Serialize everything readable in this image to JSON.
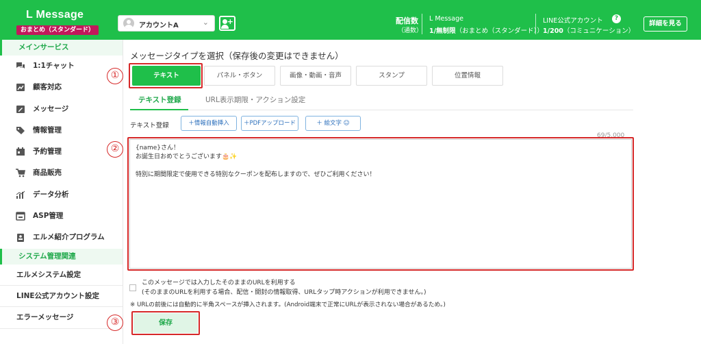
{
  "header": {
    "app_title": "L Message",
    "plan_badge": "おまとめ（スタンダード）",
    "account": "アカウントA",
    "delivery_label": "配信数",
    "delivery_sub": "（通数）",
    "lmessage_name": "L Message",
    "lmessage_value": "1/無制限",
    "lmessage_plan": "（おまとめ（スタンダード））",
    "line_name": "LINE公式アカウント",
    "line_value": "1/200",
    "line_plan": "（コミュニケーション）",
    "detail_button": "詳細を見る",
    "colors": {
      "brand": "#1fbf4a",
      "badge": "#c2185b",
      "annotation": "#d62828"
    }
  },
  "sidebar": {
    "section_main": "メインサービス",
    "items": [
      {
        "label": "1:1チャット",
        "icon": "chat-icon"
      },
      {
        "label": "顧客対応",
        "icon": "customer-icon"
      },
      {
        "label": "メッセージ",
        "icon": "message-icon"
      },
      {
        "label": "情報管理",
        "icon": "tag-icon"
      },
      {
        "label": "予約管理",
        "icon": "calendar-icon"
      },
      {
        "label": "商品販売",
        "icon": "cart-icon"
      },
      {
        "label": "データ分析",
        "icon": "analytics-icon"
      },
      {
        "label": "ASP管理",
        "icon": "asp-icon"
      },
      {
        "label": "エルメ紹介プログラム",
        "icon": "referral-icon"
      }
    ],
    "section_system": "システム管理関連",
    "system_items": [
      {
        "label": "エルメシステム設定"
      },
      {
        "label": "LINE公式アカウント設定"
      },
      {
        "label": "エラーメッセージ"
      }
    ]
  },
  "main": {
    "title": "メッセージタイプを選択（保存後の変更はできません）",
    "type_tabs": [
      {
        "label": "テキスト"
      },
      {
        "label": "パネル・ボタン"
      },
      {
        "label": "画像・動画・音声"
      },
      {
        "label": "スタンプ"
      },
      {
        "label": "位置情報"
      }
    ],
    "sub_tabs": [
      {
        "label": "テキスト登録"
      },
      {
        "label": "URL表示期限・アクション設定"
      }
    ],
    "register_label": "テキスト登録",
    "tool_buttons": [
      {
        "label": "＋情報自動挿入"
      },
      {
        "label": "＋PDFアップロード"
      },
      {
        "label": "＋ 絵文字"
      }
    ],
    "char_count": "69/5,000",
    "message_lines": [
      "{name}さん！",
      "お誕生日おめでとうございます🎂✨",
      "",
      "特別に期間限定で使用できる特別なクーポンを配布しますので、ぜひご利用ください！"
    ],
    "url_option_line1": "このメッセージでは入力したそのままのURLを利用する",
    "url_option_line2": "(そのままのURLを利用する場合、配信・開封の情報取得、URLタップ時アクションが利用できません。)",
    "url_note": "※ URLの前後には自動的に半角スペースが挿入されます。(Android端末で正常にURLが表示されない場合があるため。)",
    "save_button": "保存"
  },
  "annotations": {
    "marker_1": "①",
    "marker_2": "②",
    "marker_3": "③"
  }
}
